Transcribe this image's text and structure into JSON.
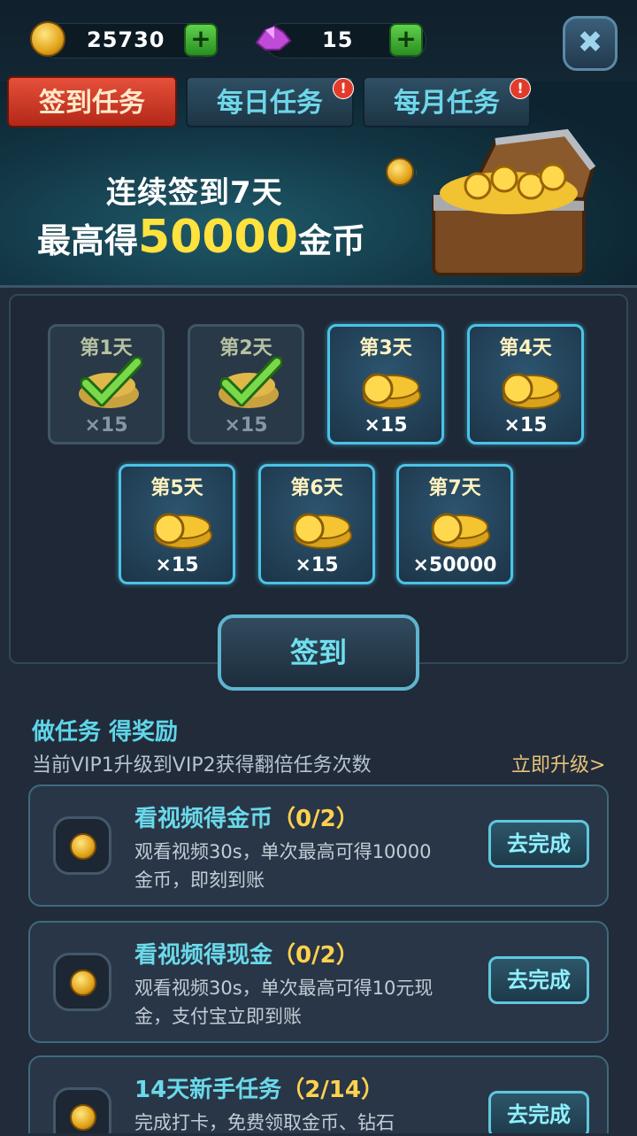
{
  "currency": {
    "coins": "25730",
    "gems": "15",
    "add_symbol": "+"
  },
  "close_symbol": "✖",
  "tabs": [
    {
      "label": "签到任务",
      "active": true,
      "alert": false
    },
    {
      "label": "每日任务",
      "active": false,
      "alert": true
    },
    {
      "label": "每月任务",
      "active": false,
      "alert": true
    }
  ],
  "alert_symbol": "!",
  "banner": {
    "line1": "连续签到7天",
    "line2_prefix": "最高得",
    "line2_amount": "50000",
    "line2_suffix": "金币"
  },
  "days": [
    {
      "label": "第1天",
      "reward": "×15",
      "claimed": true
    },
    {
      "label": "第2天",
      "reward": "×15",
      "claimed": true
    },
    {
      "label": "第3天",
      "reward": "×15",
      "claimed": false
    },
    {
      "label": "第4天",
      "reward": "×15",
      "claimed": false
    },
    {
      "label": "第5天",
      "reward": "×15",
      "claimed": false
    },
    {
      "label": "第6天",
      "reward": "×15",
      "claimed": false
    },
    {
      "label": "第7天",
      "reward": "×50000",
      "claimed": false
    }
  ],
  "sign_button": "签到",
  "tasks_section": {
    "title": "做任务 得奖励",
    "vip_text": "当前VIP1升级到VIP2获得翻倍任务次数",
    "upgrade_link": "立即升级>"
  },
  "tasks": [
    {
      "title": "看视频得金币",
      "progress": "（0/2）",
      "desc": "观看视频30s，单次最高可得10000金币，即刻到账",
      "button": "去完成"
    },
    {
      "title": "看视频得现金",
      "progress": "（0/2）",
      "desc": "观看视频30s，单次最高可得10元现金，支付宝立即到账",
      "button": "去完成"
    },
    {
      "title": "14天新手任务",
      "progress": "（2/14）",
      "desc": "完成打卡，免费领取金币、钻石",
      "button": "去完成"
    }
  ],
  "colors": {
    "accent": "#5fd5e8",
    "gold": "#ffe23d",
    "tab_active": "#d43a26"
  }
}
